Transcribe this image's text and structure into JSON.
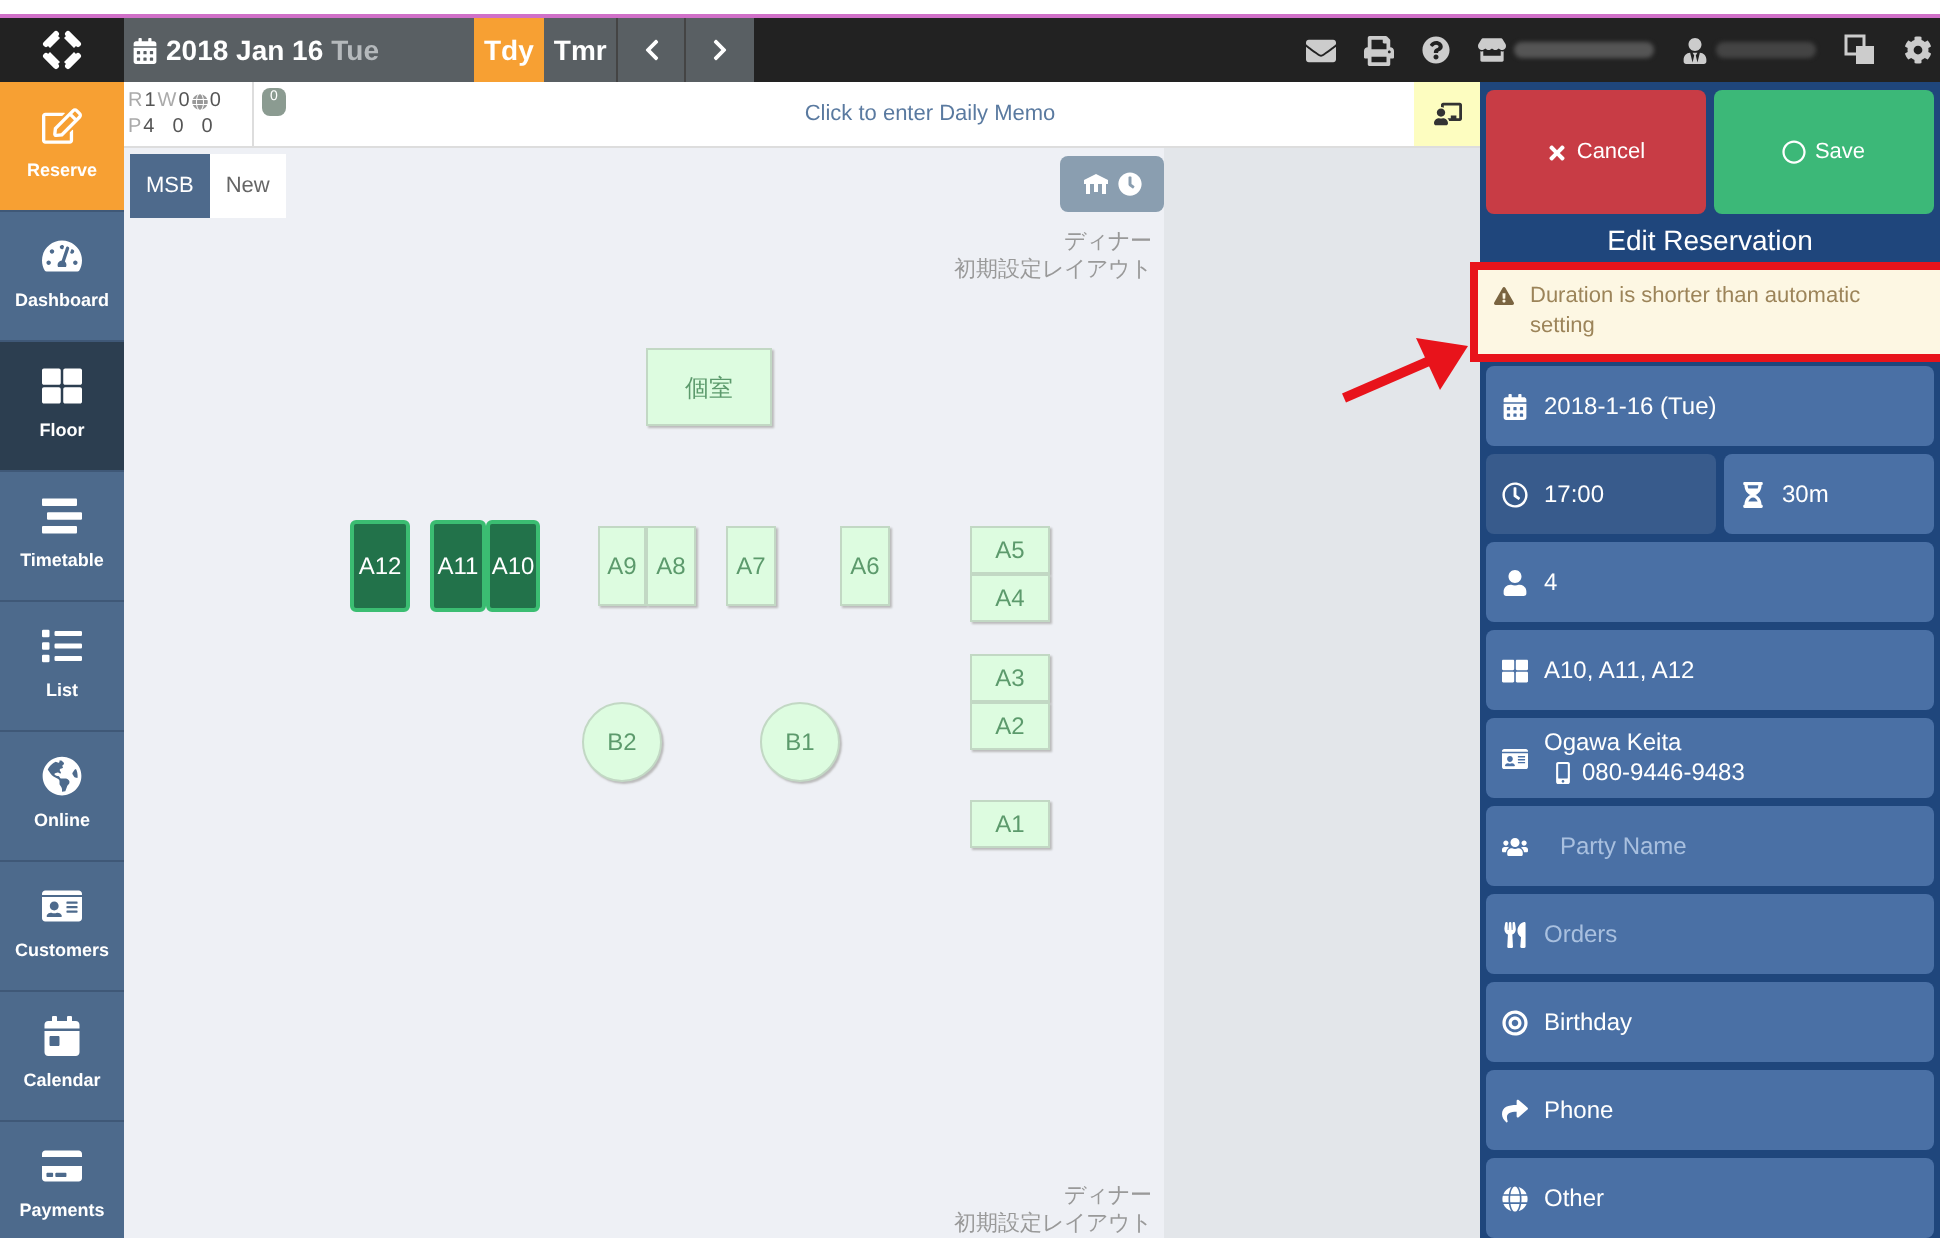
{
  "top_bar": {
    "date": "2018 Jan 16",
    "weekday": "Tue",
    "nav": [
      {
        "label": "Tdy",
        "selected": true
      },
      {
        "label": "Tmr",
        "selected": false
      }
    ]
  },
  "sidebar": {
    "items": [
      {
        "label": "Reserve",
        "kind": "action",
        "selected": false
      },
      {
        "label": "Dashboard",
        "kind": "dashboard",
        "selected": false
      },
      {
        "label": "Floor",
        "kind": "floor",
        "selected": true
      },
      {
        "label": "Timetable",
        "kind": "timetable",
        "selected": false
      },
      {
        "label": "List",
        "kind": "list",
        "selected": false
      },
      {
        "label": "Online",
        "kind": "online",
        "selected": false
      },
      {
        "label": "Customers",
        "kind": "customers",
        "selected": false
      },
      {
        "label": "Calendar",
        "kind": "calendar",
        "selected": false
      },
      {
        "label": "Payments",
        "kind": "payments",
        "selected": false
      }
    ]
  },
  "counts": {
    "row_1": [
      "R",
      "1",
      "W",
      "0",
      "0"
    ],
    "row_2": [
      "P",
      "4",
      "0",
      "0"
    ],
    "badge": "0"
  },
  "daily_memo": "Click to enter Daily Memo",
  "floor": {
    "tabs": [
      {
        "label": "MSB",
        "selected": true
      },
      {
        "label": "New",
        "selected": false
      }
    ],
    "layout_top": [
      "ディナー",
      "初期設定レイアウト"
    ],
    "layout_bottom": [
      "ディナー",
      "初期設定レイアウト"
    ],
    "tables": [
      {
        "name": "個室",
        "kind": "square",
        "selected": false
      },
      {
        "name": "A12",
        "kind": "square",
        "selected": true
      },
      {
        "name": "A11",
        "kind": "square",
        "selected": true
      },
      {
        "name": "A10",
        "kind": "square",
        "selected": true
      },
      {
        "name": "A9",
        "kind": "square",
        "selected": false
      },
      {
        "name": "A8",
        "kind": "square",
        "selected": false
      },
      {
        "name": "A7",
        "kind": "square",
        "selected": false
      },
      {
        "name": "A6",
        "kind": "square",
        "selected": false
      },
      {
        "name": "A5",
        "kind": "square",
        "selected": false
      },
      {
        "name": "A4",
        "kind": "square",
        "selected": false
      },
      {
        "name": "A3",
        "kind": "square",
        "selected": false
      },
      {
        "name": "A2",
        "kind": "square",
        "selected": false
      },
      {
        "name": "A1",
        "kind": "square",
        "selected": false
      },
      {
        "name": "B2",
        "kind": "circle",
        "selected": false
      },
      {
        "name": "B1",
        "kind": "circle",
        "selected": false
      }
    ]
  },
  "panel": {
    "cancel": "Cancel",
    "save": "Save",
    "title": "Edit Reservation",
    "warning": "Duration is shorter than automatic setting",
    "fields": [
      {
        "kind": "date",
        "value": "2018-1-16 (Tue)"
      },
      {
        "kind": "time",
        "value": "17:00",
        "selected": true
      },
      {
        "kind": "duration",
        "value": "30m",
        "selected": false
      },
      {
        "kind": "people",
        "value": "4"
      },
      {
        "kind": "tables",
        "value": "A10, A11, A12"
      },
      {
        "kind": "customer",
        "value": "Ogawa Keita",
        "phone": "080-9446-9483"
      },
      {
        "kind": "party",
        "placeholder": "Party Name"
      },
      {
        "kind": "orders",
        "placeholder": "Orders"
      },
      {
        "kind": "birthday",
        "value": "Birthday"
      },
      {
        "kind": "phone",
        "value": "Phone"
      },
      {
        "kind": "other",
        "value": "Other"
      }
    ]
  }
}
